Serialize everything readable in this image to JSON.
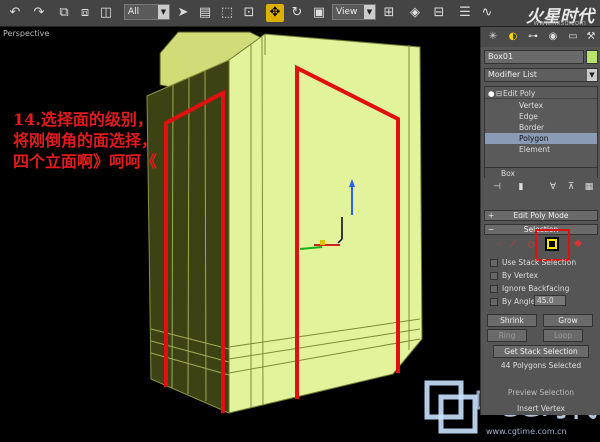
{
  "toolbar": {
    "filter_value": "All",
    "refcoord_value": "View",
    "icons": [
      "undo-icon",
      "redo-icon",
      "link-icon",
      "unlink-icon",
      "bind-icon",
      "select-icon",
      "select-by-name-icon",
      "rect-region-icon",
      "window-crossing-icon",
      "move-icon",
      "rotate-icon",
      "scale-icon",
      "pivot-icon",
      "mirror-icon",
      "align-icon",
      "layer-icon",
      "curve-editor-icon",
      "schematic-icon",
      "material-editor-icon",
      "render-setup-icon"
    ]
  },
  "logo": {
    "text": "火星时代",
    "sub": "www.hxsd.com"
  },
  "viewport": {
    "label": "Perspective"
  },
  "annotation": {
    "text": "14.选择面的级别，将刚倒角的面选择，四个立面啊》呵呵《"
  },
  "watermark": {
    "cg_text": "CG时代",
    "url": "www.cgtime.com.cn"
  },
  "panel": {
    "object_name": "Box01",
    "object_color": "#b9e36a",
    "modifier_list": "Modifier List",
    "stack": {
      "edit_poly": "Edit Poly",
      "vertex": "Vertex",
      "edge": "Edge",
      "border": "Border",
      "polygon": "Polygon",
      "element": "Element",
      "box": "Box"
    },
    "rollout_mode": "Edit Poly Mode",
    "rollout_selection": "Selection",
    "use_stack_selection": "Use Stack Selection",
    "by_vertex": "By Vertex",
    "ignore_backfacing": "Ignore Backfacing",
    "by_angle": "By Angle:",
    "by_angle_value": "45.0",
    "shrink": "Shrink",
    "grow": "Grow",
    "ring": "Ring",
    "loop": "Loop",
    "get_stack_selection": "Get Stack Selection",
    "status": "44 Polygons Selected",
    "preview": "Preview Selection",
    "insert_vertex": "Insert Vertex"
  }
}
